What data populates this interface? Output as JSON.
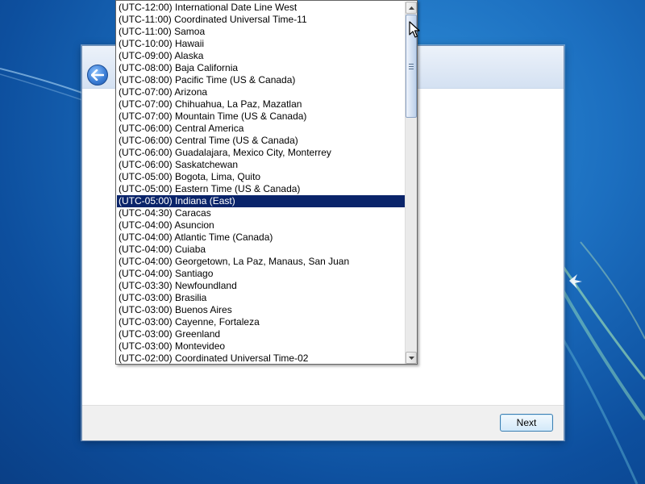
{
  "wizard": {
    "back_icon": "back-arrow-icon",
    "next_label": "Next"
  },
  "timezone_list": {
    "selected_index": 16,
    "items": [
      "(UTC-12:00) International Date Line West",
      "(UTC-11:00) Coordinated Universal Time-11",
      "(UTC-11:00) Samoa",
      "(UTC-10:00) Hawaii",
      "(UTC-09:00) Alaska",
      "(UTC-08:00) Baja California",
      "(UTC-08:00) Pacific Time (US & Canada)",
      "(UTC-07:00) Arizona",
      "(UTC-07:00) Chihuahua, La Paz, Mazatlan",
      "(UTC-07:00) Mountain Time (US & Canada)",
      "(UTC-06:00) Central America",
      "(UTC-06:00) Central Time (US & Canada)",
      "(UTC-06:00) Guadalajara, Mexico City, Monterrey",
      "(UTC-06:00) Saskatchewan",
      "(UTC-05:00) Bogota, Lima, Quito",
      "(UTC-05:00) Eastern Time (US & Canada)",
      "(UTC-05:00) Indiana (East)",
      "(UTC-04:30) Caracas",
      "(UTC-04:00) Asuncion",
      "(UTC-04:00) Atlantic Time (Canada)",
      "(UTC-04:00) Cuiaba",
      "(UTC-04:00) Georgetown, La Paz, Manaus, San Juan",
      "(UTC-04:00) Santiago",
      "(UTC-03:30) Newfoundland",
      "(UTC-03:00) Brasilia",
      "(UTC-03:00) Buenos Aires",
      "(UTC-03:00) Cayenne, Fortaleza",
      "(UTC-03:00) Greenland",
      "(UTC-03:00) Montevideo",
      "(UTC-02:00) Coordinated Universal Time-02"
    ],
    "scroll_position": 0.0
  },
  "colors": {
    "selection": "#0a246a",
    "desktop": "#1c6fc0"
  }
}
